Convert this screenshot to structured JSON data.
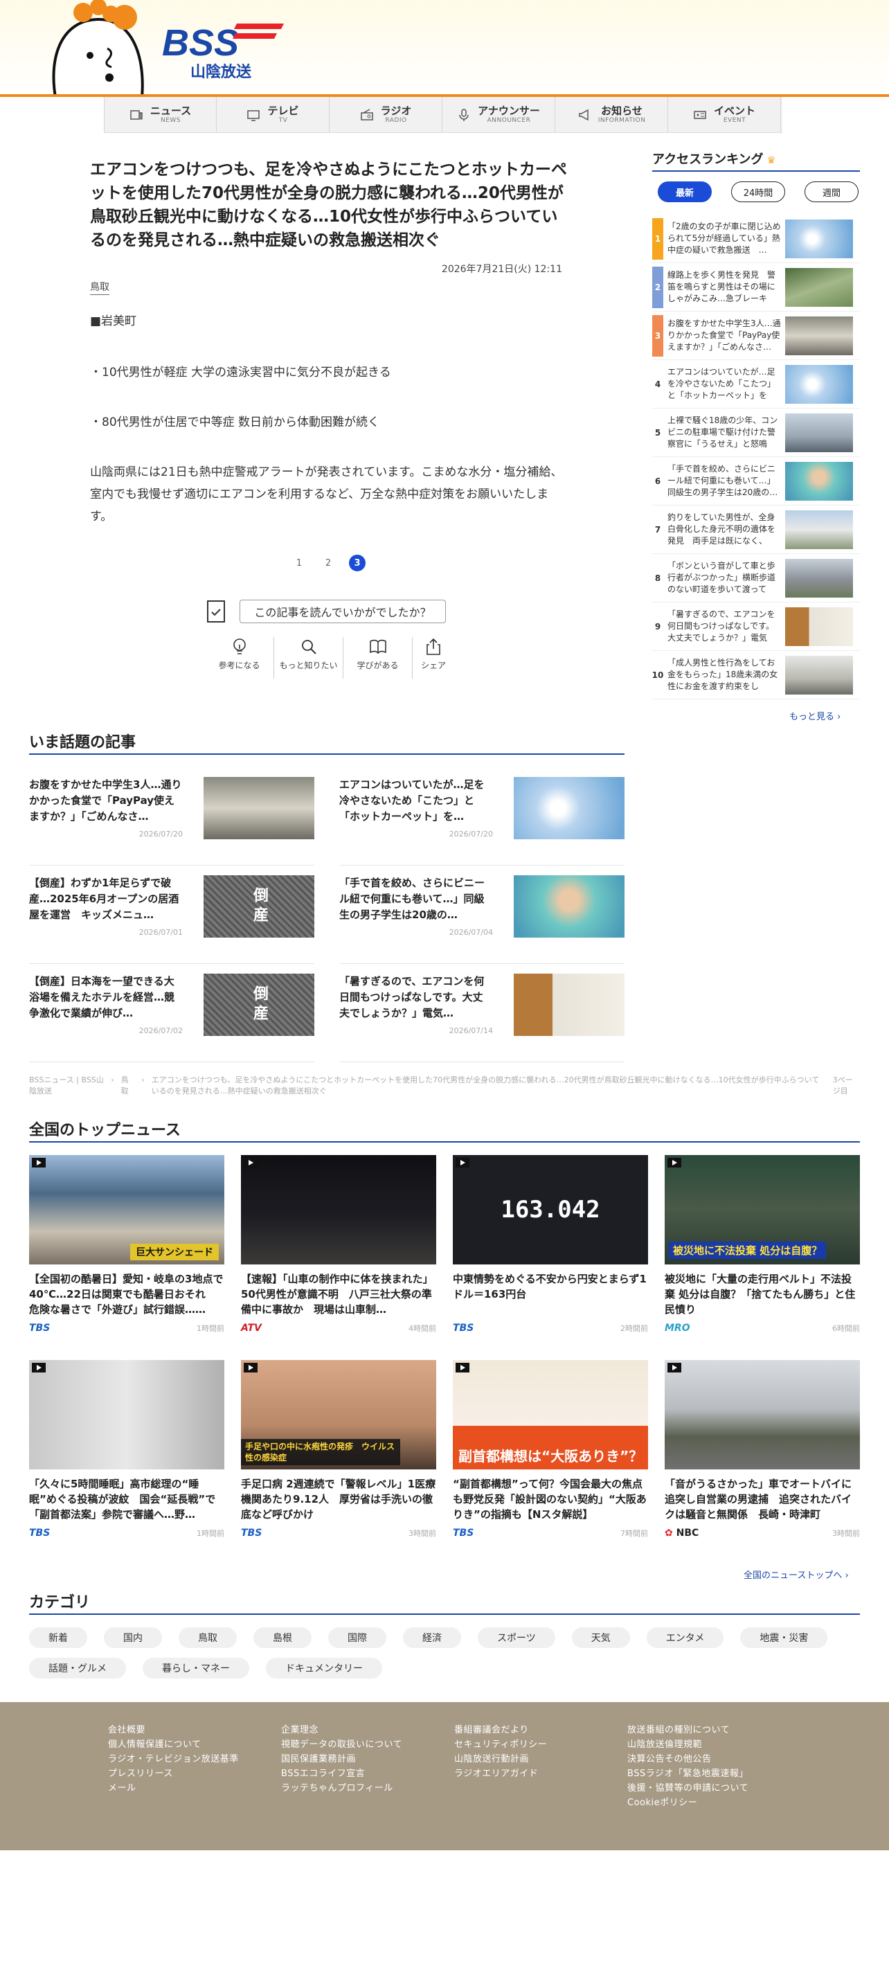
{
  "header": {
    "logo_text": "BSS",
    "logo_sub": "山陰放送"
  },
  "nav": [
    {
      "jp": "ニュース",
      "en": "NEWS",
      "icon": "news-icon"
    },
    {
      "jp": "テレビ",
      "en": "TV",
      "icon": "tv-icon"
    },
    {
      "jp": "ラジオ",
      "en": "RADIO",
      "icon": "radio-icon"
    },
    {
      "jp": "アナウンサー",
      "en": "ANNOUNCER",
      "icon": "microphone-icon"
    },
    {
      "jp": "お知らせ",
      "en": "INFORMATION",
      "icon": "megaphone-icon"
    },
    {
      "jp": "イベント",
      "en": "EVENT",
      "icon": "ticket-icon"
    }
  ],
  "article": {
    "title": "エアコンをつけつつも、足を冷やさぬようにこたつとホットカーペットを使用した70代男性が全身の脱力感に襲われる…20代男性が鳥取砂丘観光中に動けなくなる…10代女性が歩行中ふらついているのを発見される…熱中症疑いの救急搬送相次ぐ",
    "date": "2026年7月21日(火) 12:11",
    "tag": "鳥取",
    "p1": "■岩美町",
    "p2": "・10代男性が軽症 大学の遠泳実習中に気分不良が起きる",
    "p3": "・80代男性が住居で中等症 数日前から体動困難が続く",
    "p4": "山陰両県には21日も熱中症警戒アラートが発表されています。こまめな水分・塩分補給、室内でも我慢せず適切にエアコンを利用するなど、万全な熱中症対策をお願いいたします。",
    "pages": [
      "1",
      "2",
      "3"
    ],
    "feedback_question": "この記事を読んでいかがでしたか？",
    "reactions": [
      {
        "label": "参考になる",
        "icon": "lightbulb-icon"
      },
      {
        "label": "もっと知りたい",
        "icon": "search-icon"
      },
      {
        "label": "学びがある",
        "icon": "book-icon"
      },
      {
        "label": "シェア",
        "icon": "share-icon"
      }
    ]
  },
  "ranking": {
    "title": "アクセスランキング",
    "tabs": [
      "最新",
      "24時間",
      "週間"
    ],
    "more": "もっと見る ›",
    "items": [
      {
        "num": "1",
        "text": "「2歳の女の子が車に閉じ込められて5分が経過している」熱中症の疑いで救急搬送　…"
      },
      {
        "num": "2",
        "text": "線路上を歩く男性を発見　警笛を鳴らすと男性はその場にしゃがみこみ…急ブレーキか…"
      },
      {
        "num": "3",
        "text": "お腹をすかせた中学生3人…通りかかった食堂で「PayPay使えますか？」「ごめんなさ…"
      },
      {
        "num": "4",
        "text": "エアコンはついていたが…足を冷やさないため「こたつ」と「ホットカーペット」を使…"
      },
      {
        "num": "5",
        "text": "上裸で騒ぐ18歳の少年、コンビニの駐車場で駆け付けた警察官に「うるせえ」と怒鳴り…"
      },
      {
        "num": "6",
        "text": "「手で首を絞め、さらにビニール紐で何重にも巻いて…」同級生の男子学生は20歳の…"
      },
      {
        "num": "7",
        "text": "釣りをしていた男性が、全身白骨化した身元不明の遺体を発見　両手足は既になく、性…"
      },
      {
        "num": "8",
        "text": "「ボンという音がして車と歩行者がぶつかった」横断歩道のない町道を歩いて渡ってい…"
      },
      {
        "num": "9",
        "text": "「暑すぎるので、エアコンを何日間もつけっぱなしです。大丈夫でしょうか？」電気代…"
      },
      {
        "num": "10",
        "text": "「成人男性と性行為をしてお金をもらった」18歳未満の女性にお金を渡す約束をして、…"
      }
    ]
  },
  "topics": {
    "title": "いま話題の記事",
    "items": [
      {
        "title": "お腹をすかせた中学生3人…通りかかった食堂で「PayPay使えますか？」「ごめんなさ…",
        "date": "2026/07/20"
      },
      {
        "title": "エアコンはついていたが…足を冷やさないため「こたつ」と「ホットカーペット」を…",
        "date": "2026/07/20"
      },
      {
        "title": "【倒産】わずか1年足らずで破産…2025年6月オープンの居酒屋を運営　キッズメニュ…",
        "date": "2026/07/01",
        "img_text": "倒産"
      },
      {
        "title": "「手で首を絞め、さらにビニール紐で何重にも巻いて…」同級生の男子学生は20歳の…",
        "date": "2026/07/04"
      },
      {
        "title": "【倒産】日本海を一望できる大浴場を備えたホテルを経営…競争激化で業績が伸び…",
        "date": "2026/07/02",
        "img_text": "倒産"
      },
      {
        "title": "「暑すぎるので、エアコンを何日間もつけっぱなしです。大丈夫でしょうか？」電気…",
        "date": "2026/07/14"
      }
    ]
  },
  "breadcrumb": [
    "BSSニュース | BSS山陰放送",
    "鳥取",
    "エアコンをつけつつも、足を冷やさぬようにこたつとホットカーペットを使用した70代男性が全身の脱力感に襲われる…20代男性が鳥取砂丘観光中に動けなくなる…10代女性が歩行中ふらついているのを発見される…熱中症疑いの救急搬送相次ぐ",
    "3ページ目"
  ],
  "national": {
    "title": "全国のトップニュース",
    "more": "全国のニューストップへ ›",
    "items": [
      {
        "title": "【全国初の酷暑日】愛知・岐阜の3地点で40℃…22日は関東でも酷暑日おそれ　危険な暑さで「外遊び」試行錯誤……",
        "src": "TBS",
        "time": "1時間前",
        "caption": "巨大サンシェード"
      },
      {
        "title": "【速報】「山車の制作中に体を挟まれた」50代男性が意識不明　八戸三社大祭の準備中に事故か　現場は山車制…",
        "src": "ATV",
        "time": "4時間前"
      },
      {
        "title": "中東情勢をめぐる不安から円安とまらず1ドル＝163円台",
        "src": "TBS",
        "time": "2時間前",
        "caption": "163.042"
      },
      {
        "title": "被災地に「大量の走行用ベルト」不法投棄 処分は自腹？「捨てたもん勝ち」と住民憤り",
        "src": "MRO",
        "time": "6時間前",
        "caption": "被災地に不法投棄 処分は自腹？"
      },
      {
        "title": "「久々に5時間睡眠」高市総理の“睡眠”めぐる投稿が波紋　国会“延長戦”で「副首都法案」参院で審議へ…野…",
        "src": "TBS",
        "time": "1時間前"
      },
      {
        "title": "手足口病 2週連続で「警報レベル」1医療機関あたり9.12人　厚労省は手洗いの徹底など呼びかけ",
        "src": "TBS",
        "time": "3時間前",
        "caption": "手足や口の中に水疱性の発疹　ウイルス性の感染症"
      },
      {
        "title": "“副首都構想”って何？今国会最大の焦点も野党反発「設計図のない契約」“大阪ありき”の指摘も【Nスタ解説】",
        "src": "TBS",
        "time": "7時間前",
        "caption": "副首都構想は“大阪ありき”？"
      },
      {
        "title": "「音がうるさかった」車でオートバイに追突し自営業の男逮捕　追突されたバイクは騒音と無関係　長崎・時津町",
        "src": "NBC",
        "time": "3時間前"
      }
    ]
  },
  "categories": {
    "title": "カテゴリ",
    "items": [
      "新着",
      "国内",
      "鳥取",
      "島根",
      "国際",
      "経済",
      "スポーツ",
      "天気",
      "エンタメ",
      "地震・災害",
      "話題・グルメ",
      "暮らし・マネー",
      "ドキュメンタリー"
    ]
  },
  "footer": {
    "col1": [
      "会社概要",
      "個人情報保護について",
      "ラジオ・テレビジョン放送基準",
      "プレスリリース",
      "メール"
    ],
    "col2": [
      "企業理念",
      "視聴データの取扱いについて",
      "国民保護業務計画",
      "BSSエコライフ宣言",
      "ラッテちゃんプロフィール"
    ],
    "col3": [
      "番組審議会だより",
      "セキュリティポリシー",
      "山陰放送行動計画",
      "ラジオエリアガイド"
    ],
    "col4": [
      "放送番組の種別について",
      "山陰放送倫理規範",
      "決算公告その他公告",
      "BSSラジオ「緊急地震速報」",
      "後援・協賛等の申請について",
      "Cookieポリシー"
    ]
  },
  "colors": {
    "accent": "#1a47a8",
    "orange": "#f08a1c",
    "footer": "#a69a85"
  }
}
